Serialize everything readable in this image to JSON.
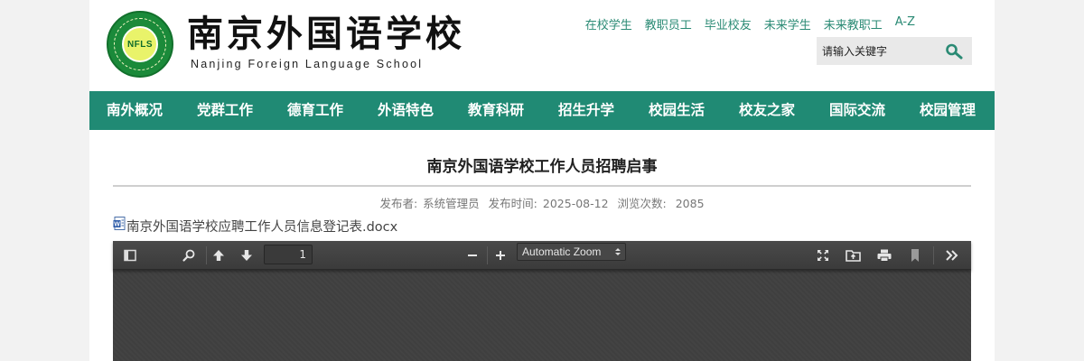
{
  "header": {
    "logo_cn": "南京外国语学校",
    "logo_en": "Nanjing Foreign Language School",
    "seal_text": "NFLS",
    "top_links": [
      "在校学生",
      "教职员工",
      "毕业校友",
      "未来学生",
      "未来教职工",
      "A-Z"
    ],
    "search": {
      "placeholder": "请输入关键字",
      "icon": "search-icon"
    }
  },
  "nav": {
    "items": [
      "南外概况",
      "党群工作",
      "德育工作",
      "外语特色",
      "教育科研",
      "招生升学",
      "校园生活",
      "校友之家",
      "国际交流",
      "校园管理"
    ]
  },
  "article": {
    "title": "南京外国语学校工作人员招聘启事",
    "meta": {
      "publisher_label": "发布者:",
      "publisher": "系统管理员",
      "time_label": "发布时间:",
      "time": "2025-08-12",
      "views_label": "浏览次数:",
      "views": "2085"
    },
    "attachment": {
      "name": "南京外国语学校应聘工作人员信息登记表.docx",
      "icon": "word-doc-icon"
    }
  },
  "viewer": {
    "page_number": "1",
    "zoom": "Automatic Zoom",
    "icons": [
      "sidebar-toggle-icon",
      "find-icon",
      "previous-page-icon",
      "next-page-icon",
      "zoom-out-icon",
      "zoom-in-icon",
      "presentation-mode-icon",
      "open-file-icon",
      "print-icon",
      "bookmark-icon",
      "tools-icon"
    ]
  },
  "colors": {
    "nav_bg": "#208a74",
    "link": "#2a8a74",
    "viewer_bg": "#404040"
  }
}
